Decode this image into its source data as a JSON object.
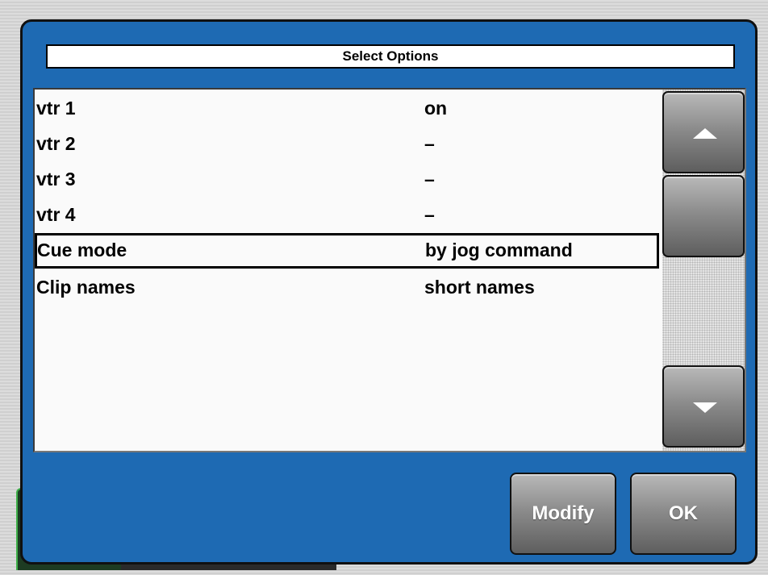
{
  "dialog": {
    "title": "Select Options"
  },
  "options": [
    {
      "name": "vtr 1",
      "value": "on"
    },
    {
      "name": "vtr 2",
      "value": "–"
    },
    {
      "name": "vtr 3",
      "value": "–"
    },
    {
      "name": "vtr 4",
      "value": "–"
    },
    {
      "name": "Cue mode",
      "value": "by jog command"
    },
    {
      "name": "Clip names",
      "value": "short names"
    }
  ],
  "selected_option": "Cue mode",
  "buttons": {
    "modify": "Modify",
    "ok": "OK"
  },
  "icons": {
    "scroll_up": "triangle-up-icon",
    "scroll_down": "triangle-down-icon"
  },
  "colors": {
    "dialog_background": "#1e6ab3",
    "list_background": "#fafafa",
    "button_gray": "#8c8c8c",
    "button_text": "#ffffff"
  }
}
